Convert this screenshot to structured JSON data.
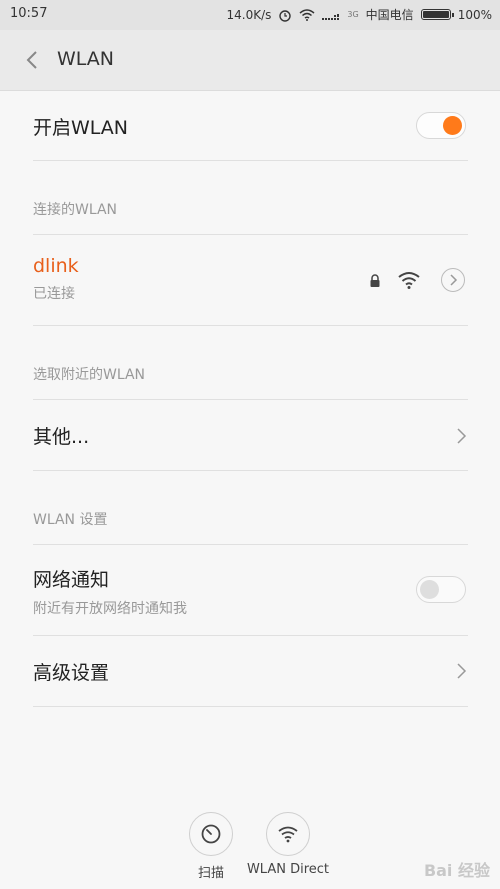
{
  "status_bar": {
    "time": "10:57",
    "speed": "14.0K/s",
    "network_type": "3G",
    "carrier": "中国电信",
    "battery": "100%"
  },
  "header": {
    "title": "WLAN"
  },
  "wlan_toggle": {
    "label": "开启WLAN",
    "on": true
  },
  "connected_section": {
    "label": "连接的WLAN",
    "network": {
      "ssid": "dlink",
      "status": "已连接"
    }
  },
  "nearby_section": {
    "label": "选取附近的WLAN",
    "other_label": "其他..."
  },
  "settings_section": {
    "label": "WLAN 设置",
    "notify": {
      "title": "网络通知",
      "subtitle": "附近有开放网络时通知我",
      "on": false
    },
    "advanced_label": "高级设置"
  },
  "bottom": {
    "scan_label": "扫描",
    "direct_label": "WLAN Direct"
  },
  "watermark": "Bai 经验",
  "colors": {
    "accent": "#ff7a1a",
    "ssid": "#e8601c"
  }
}
